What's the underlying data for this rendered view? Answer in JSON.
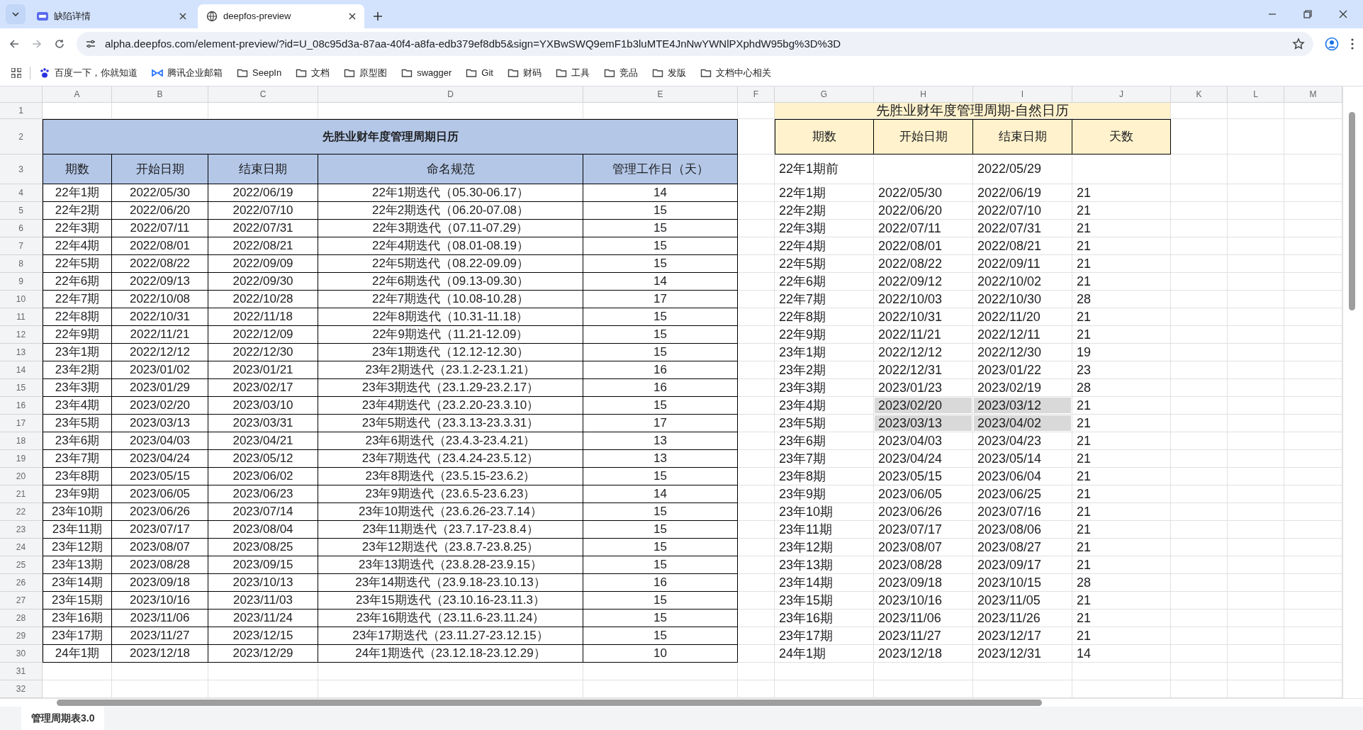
{
  "browser": {
    "tabs": [
      {
        "title": "缺陷详情",
        "selected": false
      },
      {
        "title": "deepfos-preview",
        "selected": true
      }
    ],
    "url": "alpha.deepfos.com/element-preview/?id=U_08c95d3a-87aa-40f4-a8fa-edb379ef8db5&sign=YXBwSWQ9emF1b3luMTE4JnNwYWNlPXphdW95bg%3D%3D",
    "bookmarks": [
      {
        "label": "百度一下，你就知道",
        "kind": "paw"
      },
      {
        "label": "腾讯企业邮箱",
        "kind": "mail"
      },
      {
        "label": "SeepIn",
        "kind": "folder"
      },
      {
        "label": "文档",
        "kind": "folder"
      },
      {
        "label": "原型图",
        "kind": "folder"
      },
      {
        "label": "swagger",
        "kind": "folder"
      },
      {
        "label": "Git",
        "kind": "folder"
      },
      {
        "label": "财码",
        "kind": "folder"
      },
      {
        "label": "工具",
        "kind": "folder"
      },
      {
        "label": "竞品",
        "kind": "folder"
      },
      {
        "label": "发版",
        "kind": "folder"
      },
      {
        "label": "文档中心相关",
        "kind": "folder"
      }
    ]
  },
  "sheet": {
    "column_headers": [
      "A",
      "B",
      "C",
      "D",
      "E",
      "F",
      "G",
      "H",
      "I",
      "J",
      "K",
      "L",
      "M"
    ],
    "row_headers": [
      "1",
      "2",
      "3",
      "4",
      "5",
      "6",
      "7",
      "8",
      "9",
      "10",
      "11",
      "12",
      "13",
      "14",
      "15",
      "16",
      "17",
      "18",
      "19",
      "20",
      "21",
      "22",
      "23",
      "24",
      "25",
      "26",
      "27",
      "28",
      "29",
      "30",
      "31",
      "32"
    ],
    "left_table": {
      "title": "先胜业财年度管理周期日历",
      "columns": [
        "期数",
        "开始日期",
        "结束日期",
        "命名规范",
        "管理工作日（天）"
      ],
      "rows": [
        [
          "22年1期",
          "2022/05/30",
          "2022/06/19",
          "22年1期迭代（05.30-06.17）",
          "14"
        ],
        [
          "22年2期",
          "2022/06/20",
          "2022/07/10",
          "22年2期迭代（06.20-07.08）",
          "15"
        ],
        [
          "22年3期",
          "2022/07/11",
          "2022/07/31",
          "22年3期迭代（07.11-07.29）",
          "15"
        ],
        [
          "22年4期",
          "2022/08/01",
          "2022/08/21",
          "22年4期迭代（08.01-08.19）",
          "15"
        ],
        [
          "22年5期",
          "2022/08/22",
          "2022/09/09",
          "22年5期迭代（08.22-09.09）",
          "15"
        ],
        [
          "22年6期",
          "2022/09/13",
          "2022/09/30",
          "22年6期迭代（09.13-09.30）",
          "14"
        ],
        [
          "22年7期",
          "2022/10/08",
          "2022/10/28",
          "22年7期迭代（10.08-10.28）",
          "17"
        ],
        [
          "22年8期",
          "2022/10/31",
          "2022/11/18",
          "22年8期迭代（10.31-11.18）",
          "15"
        ],
        [
          "22年9期",
          "2022/11/21",
          "2022/12/09",
          "22年9期迭代（11.21-12.09）",
          "15"
        ],
        [
          "23年1期",
          "2022/12/12",
          "2022/12/30",
          "23年1期迭代（12.12-12.30）",
          "15"
        ],
        [
          "23年2期",
          "2023/01/02",
          "2023/01/21",
          "23年2期迭代（23.1.2-23.1.21）",
          "16"
        ],
        [
          "23年3期",
          "2023/01/29",
          "2023/02/17",
          "23年3期迭代（23.1.29-23.2.17）",
          "16"
        ],
        [
          "23年4期",
          "2023/02/20",
          "2023/03/10",
          "23年4期迭代（23.2.20-23.3.10）",
          "15"
        ],
        [
          "23年5期",
          "2023/03/13",
          "2023/03/31",
          "23年5期迭代（23.3.13-23.3.31）",
          "17"
        ],
        [
          "23年6期",
          "2023/04/03",
          "2023/04/21",
          "23年6期迭代（23.4.3-23.4.21）",
          "13"
        ],
        [
          "23年7期",
          "2023/04/24",
          "2023/05/12",
          "23年7期迭代（23.4.24-23.5.12）",
          "13"
        ],
        [
          "23年8期",
          "2023/05/15",
          "2023/06/02",
          "23年8期迭代（23.5.15-23.6.2）",
          "15"
        ],
        [
          "23年9期",
          "2023/06/05",
          "2023/06/23",
          "23年9期迭代（23.6.5-23.6.23）",
          "14"
        ],
        [
          "23年10期",
          "2023/06/26",
          "2023/07/14",
          "23年10期迭代（23.6.26-23.7.14）",
          "15"
        ],
        [
          "23年11期",
          "2023/07/17",
          "2023/08/04",
          "23年11期迭代（23.7.17-23.8.4）",
          "15"
        ],
        [
          "23年12期",
          "2023/08/07",
          "2023/08/25",
          "23年12期迭代（23.8.7-23.8.25）",
          "15"
        ],
        [
          "23年13期",
          "2023/08/28",
          "2023/09/15",
          "23年13期迭代（23.8.28-23.9.15）",
          "15"
        ],
        [
          "23年14期",
          "2023/09/18",
          "2023/10/13",
          "23年14期迭代（23.9.18-23.10.13）",
          "16"
        ],
        [
          "23年15期",
          "2023/10/16",
          "2023/11/03",
          "23年15期迭代（23.10.16-23.11.3）",
          "15"
        ],
        [
          "23年16期",
          "2023/11/06",
          "2023/11/24",
          "23年16期迭代（23.11.6-23.11.24）",
          "15"
        ],
        [
          "23年17期",
          "2023/11/27",
          "2023/12/15",
          "23年17期迭代（23.11.27-23.12.15）",
          "15"
        ],
        [
          "24年1期",
          "2023/12/18",
          "2023/12/29",
          "24年1期迭代（23.12.18-23.12.29）",
          "10"
        ]
      ]
    },
    "right_table": {
      "title": "先胜业财年度管理周期-自然日历",
      "columns": [
        "期数",
        "开始日期",
        "结束日期",
        "天数"
      ],
      "rows": [
        {
          "period": "22年1期前",
          "end": "2022/05/29",
          "highlighted": false
        },
        {
          "period": "22年1期",
          "start": "2022/05/30",
          "end": "2022/06/19",
          "days": "21",
          "highlighted": false
        },
        {
          "period": "22年2期",
          "start": "2022/06/20",
          "end": "2022/07/10",
          "days": "21",
          "highlighted": false
        },
        {
          "period": "22年3期",
          "start": "2022/07/11",
          "end": "2022/07/31",
          "days": "21",
          "highlighted": false
        },
        {
          "period": "22年4期",
          "start": "2022/08/01",
          "end": "2022/08/21",
          "days": "21",
          "highlighted": false
        },
        {
          "period": "22年5期",
          "start": "2022/08/22",
          "end": "2022/09/11",
          "days": "21",
          "highlighted": false
        },
        {
          "period": "22年6期",
          "start": "2022/09/12",
          "end": "2022/10/02",
          "days": "21",
          "highlighted": false
        },
        {
          "period": "22年7期",
          "start": "2022/10/03",
          "end": "2022/10/30",
          "days": "28",
          "highlighted": false
        },
        {
          "period": "22年8期",
          "start": "2022/10/31",
          "end": "2022/11/20",
          "days": "21",
          "highlighted": false
        },
        {
          "period": "22年9期",
          "start": "2022/11/21",
          "end": "2022/12/11",
          "days": "21",
          "highlighted": false
        },
        {
          "period": "23年1期",
          "start": "2022/12/12",
          "end": "2022/12/30",
          "days": "19",
          "highlighted": false
        },
        {
          "period": "23年2期",
          "start": "2022/12/31",
          "end": "2023/01/22",
          "days": "23",
          "highlighted": false
        },
        {
          "period": "23年3期",
          "start": "2023/01/23",
          "end": "2023/02/19",
          "days": "28",
          "highlighted": false
        },
        {
          "period": "23年4期",
          "start": "2023/02/20",
          "end": "2023/03/12",
          "days": "21",
          "highlighted": true
        },
        {
          "period": "23年5期",
          "start": "2023/03/13",
          "end": "2023/04/02",
          "days": "21",
          "highlighted": true
        },
        {
          "period": "23年6期",
          "start": "2023/04/03",
          "end": "2023/04/23",
          "days": "21",
          "highlighted": false
        },
        {
          "period": "23年7期",
          "start": "2023/04/24",
          "end": "2023/05/14",
          "days": "21",
          "highlighted": false
        },
        {
          "period": "23年8期",
          "start": "2023/05/15",
          "end": "2023/06/04",
          "days": "21",
          "highlighted": false
        },
        {
          "period": "23年9期",
          "start": "2023/06/05",
          "end": "2023/06/25",
          "days": "21",
          "highlighted": false
        },
        {
          "period": "23年10期",
          "start": "2023/06/26",
          "end": "2023/07/16",
          "days": "21",
          "highlighted": false
        },
        {
          "period": "23年11期",
          "start": "2023/07/17",
          "end": "2023/08/06",
          "days": "21",
          "highlighted": false
        },
        {
          "period": "23年12期",
          "start": "2023/08/07",
          "end": "2023/08/27",
          "days": "21",
          "highlighted": false
        },
        {
          "period": "23年13期",
          "start": "2023/08/28",
          "end": "2023/09/17",
          "days": "21",
          "highlighted": false
        },
        {
          "period": "23年14期",
          "start": "2023/09/18",
          "end": "2023/10/15",
          "days": "28",
          "highlighted": false
        },
        {
          "period": "23年15期",
          "start": "2023/10/16",
          "end": "2023/11/05",
          "days": "21",
          "highlighted": false
        },
        {
          "period": "23年16期",
          "start": "2023/11/06",
          "end": "2023/11/26",
          "days": "21",
          "highlighted": false
        },
        {
          "period": "23年17期",
          "start": "2023/11/27",
          "end": "2023/12/17",
          "days": "21",
          "highlighted": false
        },
        {
          "period": "24年1期",
          "start": "2023/12/18",
          "end": "2023/12/31",
          "days": "14",
          "highlighted": false
        }
      ]
    },
    "sheet_tabs": [
      {
        "label": "管理周期表3.0",
        "selected": true
      }
    ]
  }
}
